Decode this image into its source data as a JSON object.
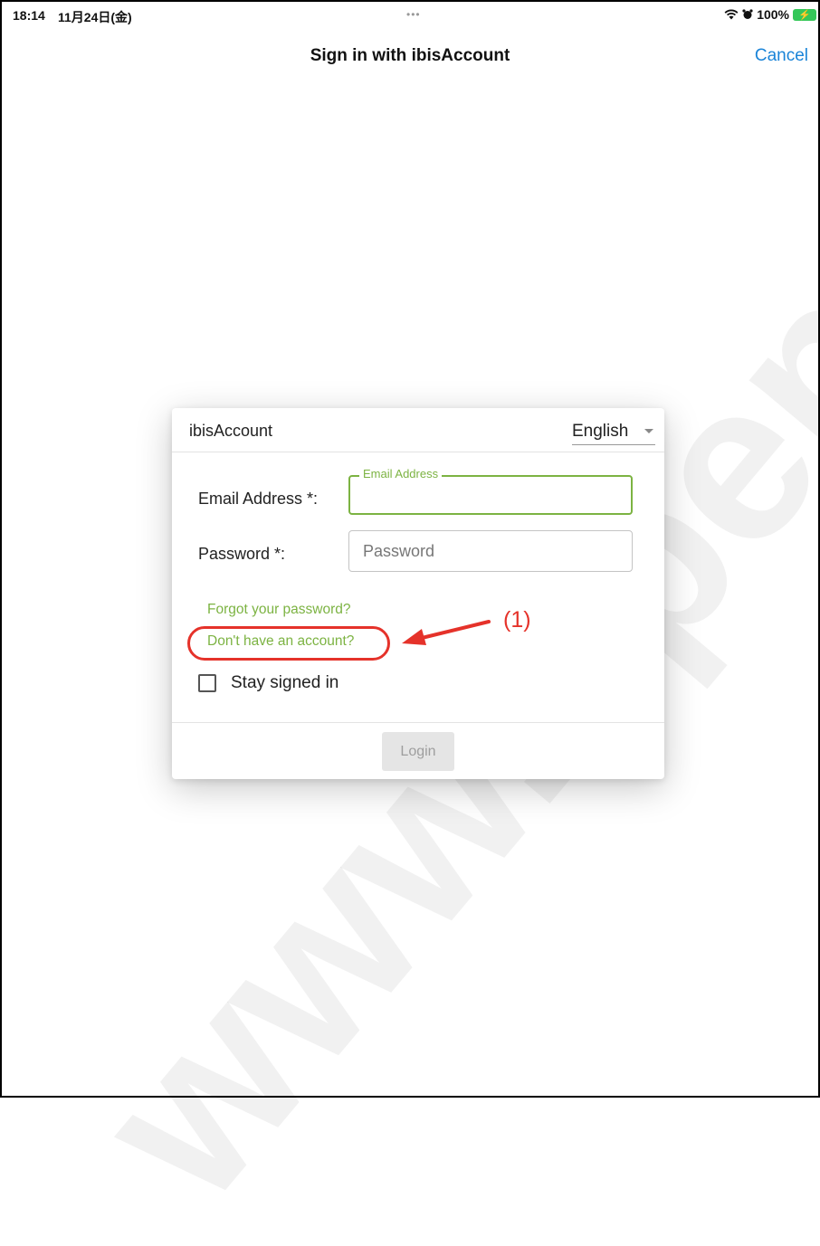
{
  "status_bar": {
    "time": "18:14",
    "date": "11月24日(金)",
    "multitask_dots": "•••",
    "battery_percent": "100%",
    "battery_icon": "battery-charging-icon"
  },
  "nav": {
    "title": "Sign in with ibisAccount",
    "cancel_label": "Cancel"
  },
  "watermark": {
    "text": "www.xpen.te"
  },
  "dialog": {
    "title": "ibisAccount",
    "language": "English",
    "email": {
      "label": "Email Address *:",
      "legend": "Email Address",
      "value": ""
    },
    "password": {
      "label": "Password *:",
      "placeholder": "Password",
      "value": ""
    },
    "forgot_link": "Forgot your password?",
    "signup_link": "Don't have an account?",
    "stay_signed_in": {
      "label": "Stay signed in",
      "checked": false
    },
    "login_label": "Login"
  },
  "annotation": {
    "label": "(1)",
    "color": "#e5322a"
  },
  "colors": {
    "accent_green": "#7cb342",
    "ios_blue": "#1a84d8",
    "annotation_red": "#e5322a"
  }
}
